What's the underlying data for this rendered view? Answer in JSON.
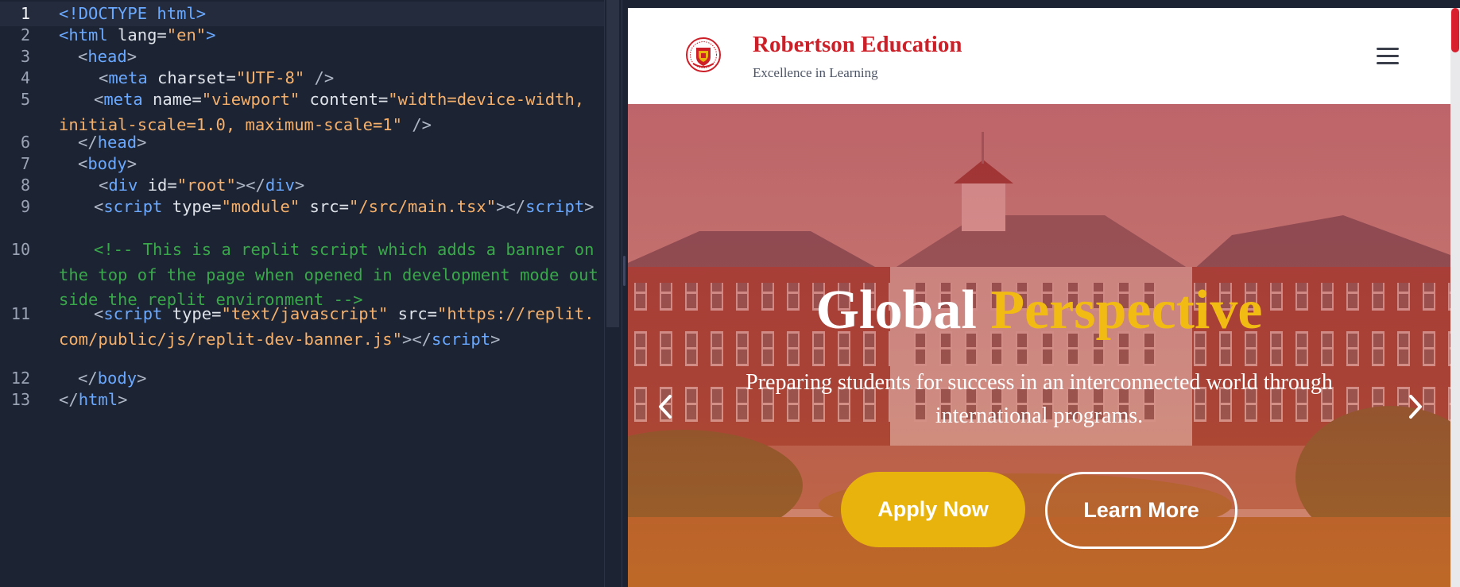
{
  "editor": {
    "lines": [
      {
        "num": "1",
        "parts": [
          {
            "c": "t",
            "v": "<!DOCTYPE html>"
          }
        ]
      },
      {
        "num": "2",
        "parts": [
          {
            "c": "t",
            "v": "<html"
          },
          {
            "c": "a",
            "v": " lang="
          },
          {
            "c": "s",
            "v": "\"en\""
          },
          {
            "c": "t",
            "v": ">"
          }
        ]
      },
      {
        "num": "3",
        "indent": 1,
        "parts": [
          {
            "c": "p",
            "v": "<"
          },
          {
            "c": "t",
            "v": "head"
          },
          {
            "c": "p",
            "v": ">"
          }
        ]
      },
      {
        "num": "4",
        "indent": 2,
        "parts": [
          {
            "c": "p",
            "v": "<"
          },
          {
            "c": "t",
            "v": "meta"
          },
          {
            "c": "a",
            "v": " charset="
          },
          {
            "c": "s",
            "v": "\"UTF-8\""
          },
          {
            "c": "p",
            "v": " />"
          }
        ]
      },
      {
        "num": "5",
        "indent": 2,
        "wrap": true,
        "parts": [
          {
            "c": "p",
            "v": "<"
          },
          {
            "c": "t",
            "v": "meta"
          },
          {
            "c": "a",
            "v": " name="
          },
          {
            "c": "s",
            "v": "\"viewport\""
          },
          {
            "c": "a",
            "v": " content="
          },
          {
            "c": "s",
            "v": "\"width=device-width, initial-scale=1.0, maximum-scale=1\""
          },
          {
            "c": "p",
            "v": " />"
          }
        ]
      },
      {
        "num": "6",
        "indent": 1,
        "parts": [
          {
            "c": "p",
            "v": "</"
          },
          {
            "c": "t",
            "v": "head"
          },
          {
            "c": "p",
            "v": ">"
          }
        ]
      },
      {
        "num": "7",
        "indent": 1,
        "parts": [
          {
            "c": "p",
            "v": "<"
          },
          {
            "c": "t",
            "v": "body"
          },
          {
            "c": "p",
            "v": ">"
          }
        ]
      },
      {
        "num": "8",
        "indent": 2,
        "parts": [
          {
            "c": "p",
            "v": "<"
          },
          {
            "c": "t",
            "v": "div"
          },
          {
            "c": "a",
            "v": " id="
          },
          {
            "c": "s",
            "v": "\"root\""
          },
          {
            "c": "p",
            "v": "></"
          },
          {
            "c": "t",
            "v": "div"
          },
          {
            "c": "p",
            "v": ">"
          }
        ]
      },
      {
        "num": "9",
        "indent": 2,
        "wrap": true,
        "parts": [
          {
            "c": "p",
            "v": "<"
          },
          {
            "c": "t",
            "v": "script"
          },
          {
            "c": "a",
            "v": " type="
          },
          {
            "c": "s",
            "v": "\"module\""
          },
          {
            "c": "a",
            "v": " src="
          },
          {
            "c": "s",
            "v": "\"/src/main.tsx\""
          },
          {
            "c": "p",
            "v": ">"
          },
          {
            "c": "p",
            "v": "</"
          },
          {
            "c": "t",
            "v": "script"
          },
          {
            "c": "p",
            "v": ">"
          }
        ]
      },
      {
        "num": "10",
        "indent": 2,
        "wrap": true,
        "parts": [
          {
            "c": "c",
            "v": "<!-- This is a replit script which adds a banner on the top of the page when opened in development mode outside the replit environment -->"
          }
        ]
      },
      {
        "num": "11",
        "indent": 2,
        "wrap": true,
        "parts": [
          {
            "c": "p",
            "v": "<"
          },
          {
            "c": "t",
            "v": "script"
          },
          {
            "c": "a",
            "v": " type="
          },
          {
            "c": "s",
            "v": "\"text/javascript\""
          },
          {
            "c": "a",
            "v": " src="
          },
          {
            "c": "s",
            "v": "\"https://replit.com/public/js/replit-dev-banner.js\""
          },
          {
            "c": "p",
            "v": "></"
          },
          {
            "c": "t",
            "v": "script"
          },
          {
            "c": "p",
            "v": ">"
          }
        ]
      },
      {
        "num": "12",
        "indent": 1,
        "parts": [
          {
            "c": "p",
            "v": "</"
          },
          {
            "c": "t",
            "v": "body"
          },
          {
            "c": "p",
            "v": ">"
          }
        ]
      },
      {
        "num": "13",
        "parts": [
          {
            "c": "p",
            "v": "</"
          },
          {
            "c": "t",
            "v": "html"
          },
          {
            "c": "p",
            "v": ">"
          }
        ]
      }
    ]
  },
  "site": {
    "brand": {
      "name": "Robertson Education",
      "tagline": "Excellence in Learning"
    },
    "hero": {
      "title_main": "Global",
      "title_highlight": "Perspective",
      "subtitle": "Preparing students for success in an interconnected world through international programs.",
      "apply_label": "Apply Now",
      "learn_label": "Learn More"
    },
    "colors": {
      "brand_red": "#cc1f28",
      "accent_gold": "#e8b30c"
    },
    "icons": {
      "menu": "hamburger-menu-icon",
      "prev": "chevron-left-icon",
      "next": "chevron-right-icon",
      "logo": "school-crest-logo"
    }
  }
}
